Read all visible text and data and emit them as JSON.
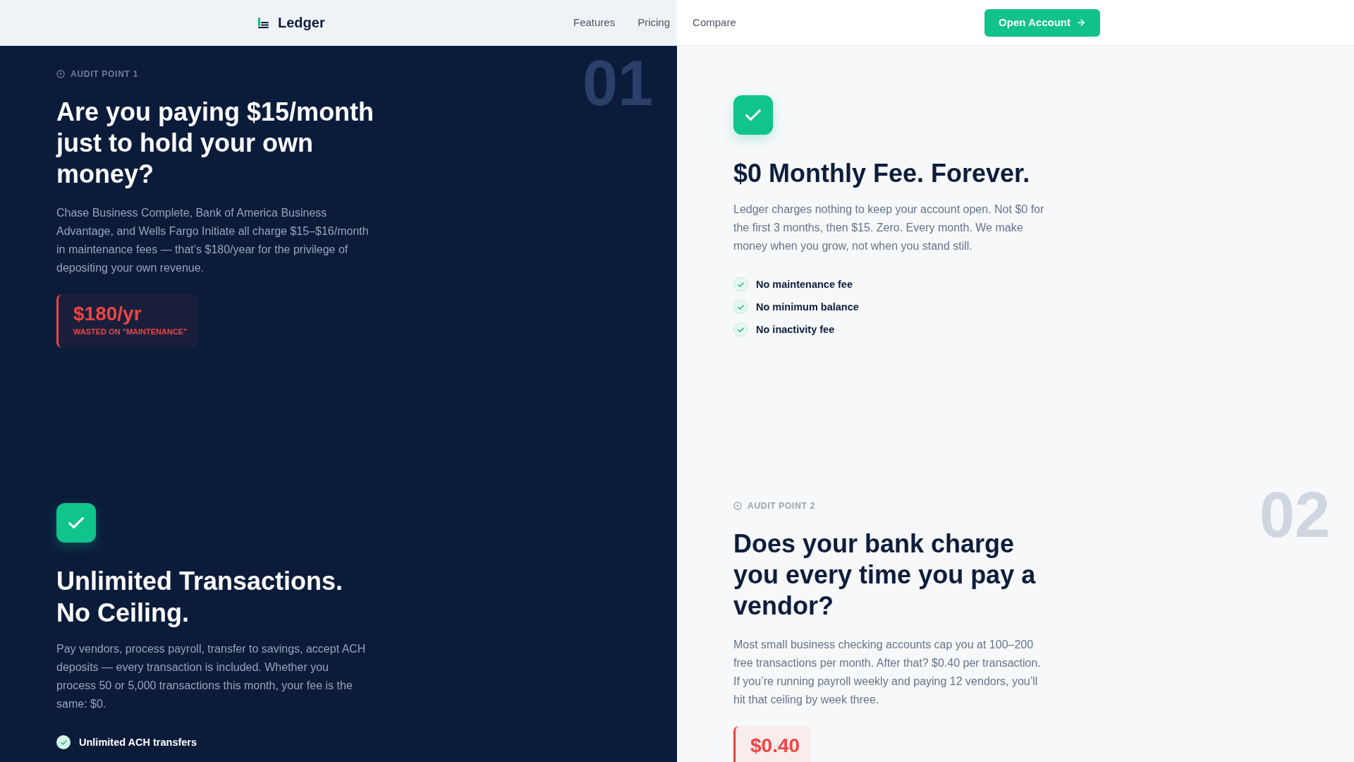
{
  "header": {
    "logo": "Ledger",
    "nav": [
      "Features",
      "Pricing",
      "Compare"
    ],
    "cta": "Open Account"
  },
  "sections": [
    {
      "kind": "question",
      "number": "01",
      "eyebrow": "AUDIT POINT 1",
      "title": "Are you paying $15/month just to hold your own money?",
      "body": "Chase Business Complete, Bank of America Business Advantage, and Wells Fargo Initiate all charge $15–$16/month in maintenance fees — that’s $180/year for the privilege of depositing your own revenue.",
      "stat": {
        "value": "$180/yr",
        "caption": "WASTED ON \"MAINTENANCE\""
      }
    },
    {
      "kind": "answer",
      "title": "$0 Monthly Fee. Forever.",
      "body": "Ledger charges nothing to keep your account open. Not $0 for the first 3 months, then $15. Zero. Every month. We make money when you grow, not when you stand still.",
      "features": [
        "No maintenance fee",
        "No minimum balance",
        "No inactivity fee"
      ]
    },
    {
      "kind": "answer",
      "title": "Unlimited Transactions. No Ceiling.",
      "body": "Pay vendors, process payroll, transfer to savings, accept ACH deposits — every transaction is included. Whether you process 50 or 5,000 transactions this month, your fee is the same: $0.",
      "features": [
        "Unlimited ACH transfers"
      ]
    },
    {
      "kind": "question",
      "number": "02",
      "eyebrow": "AUDIT POINT 2",
      "title": "Does your bank charge you every time you pay a vendor?",
      "body": "Most small business checking accounts cap you at 100–200 free transactions per month. After that? $0.40 per transaction. If you’re running payroll weekly and paying 12 vendors, you’ll hit that ceiling by week three.",
      "stat": {
        "value": "$0.40"
      }
    }
  ]
}
